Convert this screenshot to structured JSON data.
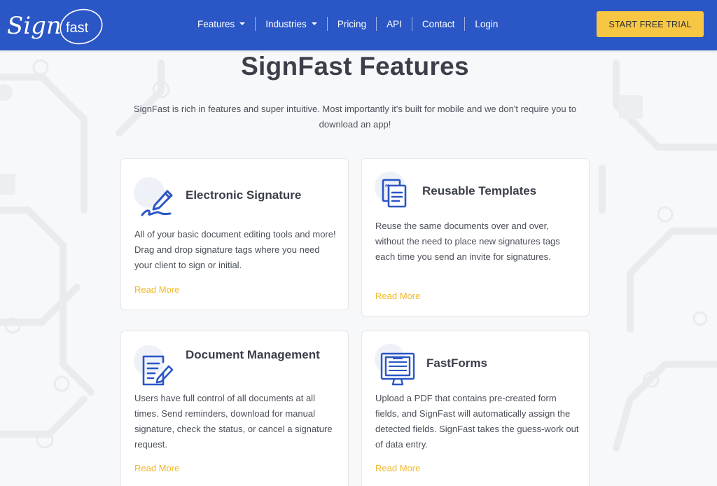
{
  "nav": {
    "logo_text_script": "Sign",
    "logo_text_plain": "fast",
    "items": [
      {
        "label": "Features",
        "has_dropdown": true
      },
      {
        "label": "Industries",
        "has_dropdown": true
      },
      {
        "label": "Pricing",
        "has_dropdown": false
      },
      {
        "label": "API",
        "has_dropdown": false
      },
      {
        "label": "Contact",
        "has_dropdown": false
      },
      {
        "label": "Login",
        "has_dropdown": false
      }
    ],
    "cta_label": "START FREE TRIAL"
  },
  "hero": {
    "title": "SignFast Features",
    "subtitle": "SignFast is rich in features and super intuitive.  Most importantly it's built for mobile and we don't require you to download an app!"
  },
  "features": [
    {
      "title": "Electronic Signature",
      "description": "All of your basic document editing tools and more! Drag and drop signature tags where you need your client to sign or initial.",
      "link": "Read More",
      "icon": "signature-pen-icon"
    },
    {
      "title": "Reusable Templates",
      "description": "Reuse the same documents over and over, without the need to place new signatures tags each time you send an invite for signatures.",
      "link": "Read More",
      "icon": "templates-icon"
    },
    {
      "title": "Document Management",
      "description": "Users have full control of all documents at all times. Send reminders, download for manual signature, check the status, or cancel a signature request.",
      "link": "Read More",
      "icon": "document-edit-icon"
    },
    {
      "title": "FastForms",
      "description": "Upload a PDF that contains pre-created form fields, and SignFast will automatically assign the detected fields. SignFast takes the guess-work out of data entry.",
      "link": "Read More",
      "icon": "form-monitor-icon"
    }
  ],
  "colors": {
    "nav_bg": "#2a56c6",
    "cta_bg": "#f7c744",
    "icon_blue": "#2a56c6",
    "link_gold": "#f0b92c",
    "heading": "#3b3f4a"
  }
}
